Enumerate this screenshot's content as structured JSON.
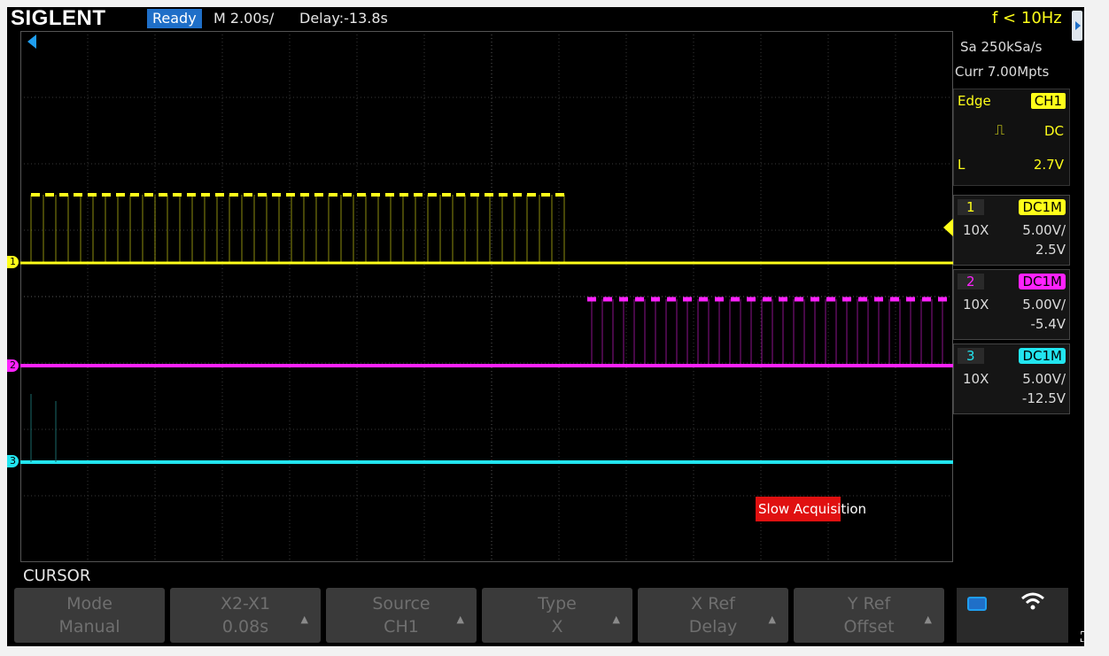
{
  "brand": "SIGLENT",
  "status": "Ready",
  "timebase": "M 2.00s/",
  "delay": "Delay:-13.8s",
  "trigger_freq": "f < 10Hz",
  "sample_rate": "Sa 250kSa/s",
  "memory": "Curr 7.00Mpts",
  "trigger": {
    "type": "Edge",
    "source": "CH1",
    "coupling": "DC",
    "level_label": "L",
    "level": "2.7V"
  },
  "channels": [
    {
      "num": "1",
      "coupling": "DC1M",
      "probe": "10X",
      "scale": "5.00V/",
      "offset": "2.5V",
      "color": "#ffff1a"
    },
    {
      "num": "2",
      "coupling": "DC1M",
      "probe": "10X",
      "scale": "5.00V/",
      "offset": "-5.4V",
      "color": "#ff22ff"
    },
    {
      "num": "3",
      "coupling": "DC1M",
      "probe": "10X",
      "scale": "5.00V/",
      "offset": "-12.5V",
      "color": "#22e5f0"
    }
  ],
  "markers": {
    "ch1": "1",
    "ch2": "2",
    "ch3": "3"
  },
  "slow_acq": {
    "highlight": "Slow Acquisi",
    "rest": "tion"
  },
  "menu_title": "CURSOR",
  "softkeys": [
    {
      "title": "Mode",
      "value": "Manual"
    },
    {
      "title": "X2-X1",
      "value": "0.08s"
    },
    {
      "title": "Source",
      "value": "CH1"
    },
    {
      "title": "Type",
      "value": "X"
    },
    {
      "title": "X Ref",
      "value": "Delay"
    },
    {
      "title": "Y Ref",
      "value": "Offset"
    }
  ],
  "icons": {
    "battery": "battery-icon",
    "wifi": "wifi-icon",
    "expand": "expand-icon"
  }
}
